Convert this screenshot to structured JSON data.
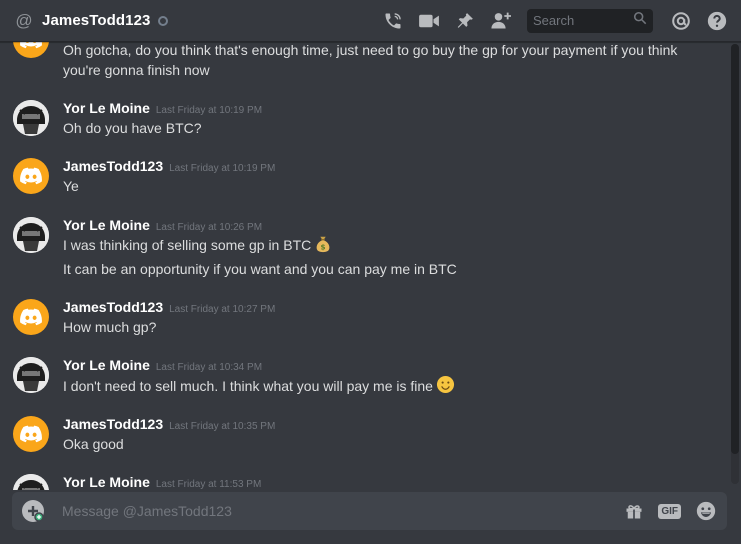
{
  "header": {
    "channel_name": "JamesTodd123",
    "search_placeholder": "Search"
  },
  "messages": [
    {
      "author": "",
      "timestamp": "",
      "lines": [
        "Oh gotcha, do you think that's enough time, just need to go buy the gp for your payment if you think",
        "you're gonna finish now"
      ]
    },
    {
      "author": "Yor Le Moine",
      "timestamp": "Last Friday at 10:19 PM",
      "lines": [
        "Oh do you have BTC?"
      ]
    },
    {
      "author": "JamesTodd123",
      "timestamp": "Last Friday at 10:19 PM",
      "lines": [
        "Ye"
      ]
    },
    {
      "author": "Yor Le Moine",
      "timestamp": "Last Friday at 10:26 PM",
      "lines": [
        "I was thinking of selling some gp in BTC",
        "It can be an opportunity if you want and you can pay me in BTC"
      ]
    },
    {
      "author": "JamesTodd123",
      "timestamp": "Last Friday at 10:27 PM",
      "lines": [
        "How much gp?"
      ]
    },
    {
      "author": "Yor Le Moine",
      "timestamp": "Last Friday at 10:34 PM",
      "lines": [
        "I don't need to sell much. I think what you will pay me is fine"
      ]
    },
    {
      "author": "JamesTodd123",
      "timestamp": "Last Friday at 10:35 PM",
      "lines": [
        "Oka good"
      ]
    },
    {
      "author": "Yor Le Moine",
      "timestamp": "Last Friday at 11:53 PM",
      "lines": []
    }
  ],
  "composer": {
    "placeholder": "Message @JamesTodd123",
    "gif_label": "GIF"
  },
  "colors": {
    "background": "#36393f",
    "discord_avatar": "#faa61a",
    "composer_bg": "#40444b"
  },
  "icons": [
    "at-icon",
    "status-offline-icon",
    "call-icon",
    "video-icon",
    "pin-icon",
    "add-friend-icon",
    "search-icon",
    "mentions-icon",
    "help-icon",
    "upload-icon",
    "gift-icon",
    "gif-icon",
    "emoji-icon",
    "money-bag-emoji",
    "smile-emoji"
  ]
}
